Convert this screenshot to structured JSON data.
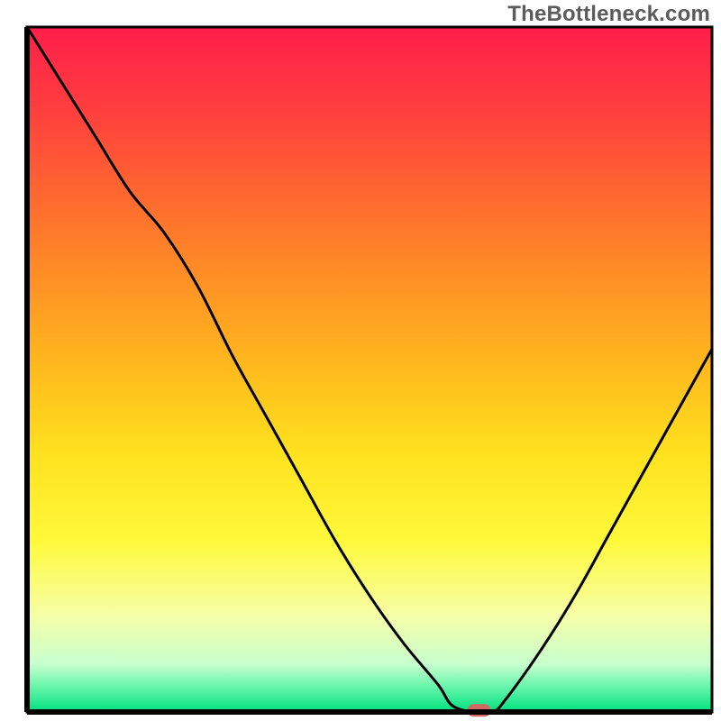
{
  "watermark": "TheBottleneck.com",
  "chart_data": {
    "type": "line",
    "title": "",
    "xlabel": "",
    "ylabel": "",
    "xlim": [
      0,
      100
    ],
    "ylim": [
      0,
      100
    ],
    "grid": false,
    "legend": false,
    "series": [
      {
        "name": "bottleneck-curve",
        "x": [
          0,
          5,
          10,
          15,
          20,
          25,
          30,
          35,
          40,
          45,
          50,
          55,
          60,
          62,
          65,
          68,
          70,
          75,
          80,
          85,
          90,
          95,
          100
        ],
        "y": [
          100,
          92,
          84,
          76,
          70,
          62,
          52,
          43,
          34,
          25,
          17,
          10,
          4,
          1,
          0,
          0,
          2,
          9,
          17,
          26,
          35,
          44,
          53
        ]
      }
    ],
    "marker": {
      "x": 66,
      "y": 0,
      "color": "#cf6a66",
      "shape": "rounded-rect"
    },
    "background_gradient": {
      "stops": [
        {
          "offset": 0.0,
          "color": "#ff1e4b"
        },
        {
          "offset": 0.12,
          "color": "#ff3e3e"
        },
        {
          "offset": 0.3,
          "color": "#ff7a2a"
        },
        {
          "offset": 0.48,
          "color": "#ffb41e"
        },
        {
          "offset": 0.62,
          "color": "#ffe11e"
        },
        {
          "offset": 0.75,
          "color": "#fff93a"
        },
        {
          "offset": 0.86,
          "color": "#f6ffa8"
        },
        {
          "offset": 0.93,
          "color": "#c7ffce"
        },
        {
          "offset": 0.965,
          "color": "#62f5a9"
        },
        {
          "offset": 1.0,
          "color": "#00e07e"
        }
      ]
    },
    "frame_color": "#000000",
    "curve_color": "#000000"
  }
}
